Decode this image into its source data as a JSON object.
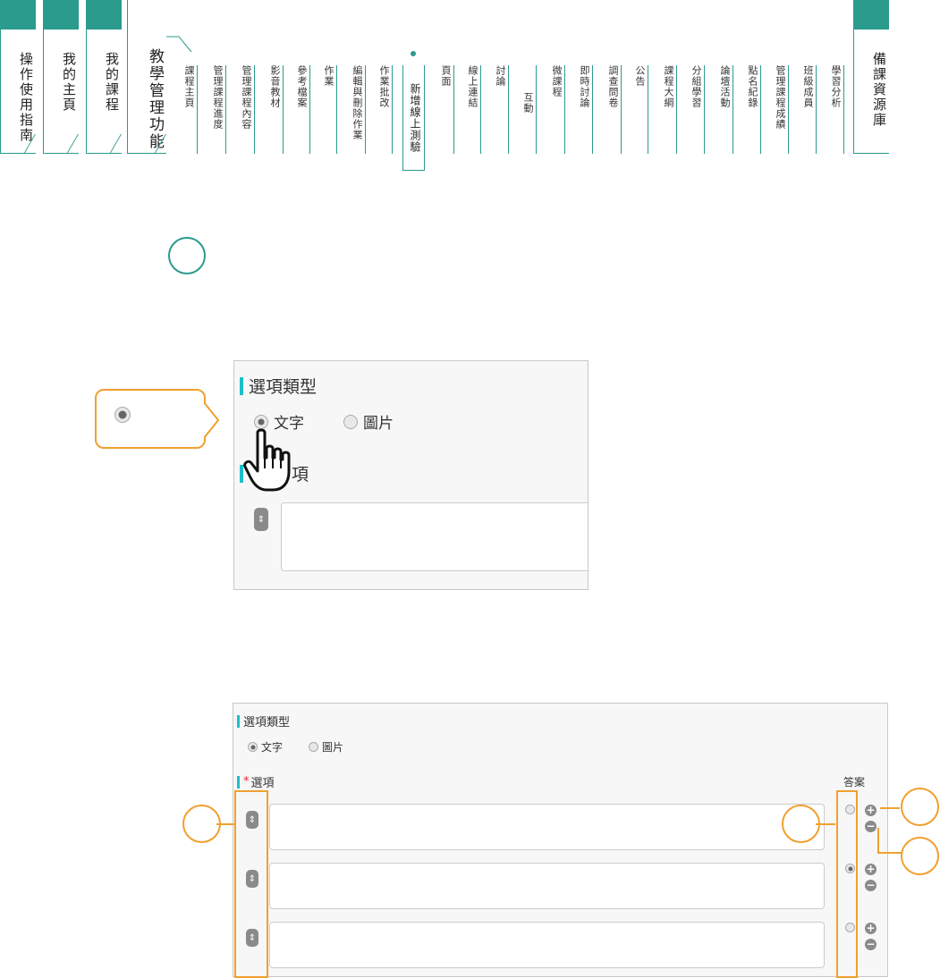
{
  "nav": {
    "main_tabs": [
      {
        "label": "操作使用指南"
      },
      {
        "label": "我的主頁"
      },
      {
        "label": "我的課程"
      },
      {
        "label": "教學管理功能"
      }
    ],
    "sub_items": [
      "課程主頁",
      "管理課程進度",
      "管理課程內容",
      "影音教材",
      "參考檔案",
      "作業",
      "編輯與刪除作業",
      "作業批改",
      "新增線上測驗",
      "頁面",
      "線上連結",
      "討論",
      "互動",
      "微課程",
      "即時討論",
      "調查問卷",
      "公告",
      "課程大綱",
      "分組學習",
      "論壇活動",
      "點名紀錄",
      "管理課程成績",
      "班級成員",
      "學習分析"
    ],
    "right_tab": {
      "label": "備課資源庫"
    },
    "accent_color": "#2a9b8c"
  },
  "zoom_panel": {
    "section_title": "選項類型",
    "option_text": "文字",
    "option_image": "圖片",
    "selected": "文字",
    "options_title_partial": "項",
    "cursor_icon": "hand-pointer-icon"
  },
  "detail_panel": {
    "section_title": "選項類型",
    "option_text": "文字",
    "option_image": "圖片",
    "options_title": "選項",
    "required_mark": "*",
    "answer_header": "答案",
    "rows": [
      {
        "answer_selected": false
      },
      {
        "answer_selected": true
      },
      {
        "answer_selected": false
      }
    ],
    "add_icon": "plus-circle-icon",
    "remove_icon": "minus-circle-icon"
  },
  "colors": {
    "teal": "#2a9b8c",
    "cyan_bar": "#1cbfc9",
    "orange": "#f0a030"
  }
}
